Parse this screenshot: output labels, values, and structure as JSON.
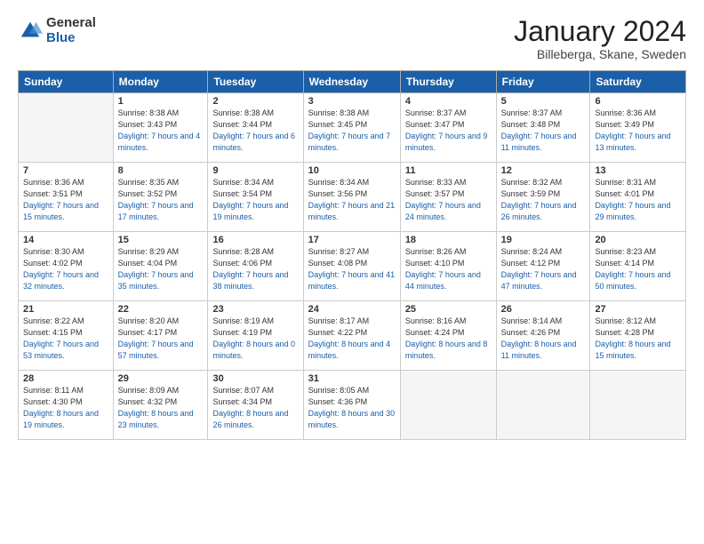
{
  "header": {
    "logo_general": "General",
    "logo_blue": "Blue",
    "month_title": "January 2024",
    "location": "Billeberga, Skane, Sweden"
  },
  "weekdays": [
    "Sunday",
    "Monday",
    "Tuesday",
    "Wednesday",
    "Thursday",
    "Friday",
    "Saturday"
  ],
  "weeks": [
    [
      {
        "day": "",
        "sunrise": "",
        "sunset": "",
        "daylight": ""
      },
      {
        "day": "1",
        "sunrise": "Sunrise: 8:38 AM",
        "sunset": "Sunset: 3:43 PM",
        "daylight": "Daylight: 7 hours and 4 minutes."
      },
      {
        "day": "2",
        "sunrise": "Sunrise: 8:38 AM",
        "sunset": "Sunset: 3:44 PM",
        "daylight": "Daylight: 7 hours and 6 minutes."
      },
      {
        "day": "3",
        "sunrise": "Sunrise: 8:38 AM",
        "sunset": "Sunset: 3:45 PM",
        "daylight": "Daylight: 7 hours and 7 minutes."
      },
      {
        "day": "4",
        "sunrise": "Sunrise: 8:37 AM",
        "sunset": "Sunset: 3:47 PM",
        "daylight": "Daylight: 7 hours and 9 minutes."
      },
      {
        "day": "5",
        "sunrise": "Sunrise: 8:37 AM",
        "sunset": "Sunset: 3:48 PM",
        "daylight": "Daylight: 7 hours and 11 minutes."
      },
      {
        "day": "6",
        "sunrise": "Sunrise: 8:36 AM",
        "sunset": "Sunset: 3:49 PM",
        "daylight": "Daylight: 7 hours and 13 minutes."
      }
    ],
    [
      {
        "day": "7",
        "sunrise": "Sunrise: 8:36 AM",
        "sunset": "Sunset: 3:51 PM",
        "daylight": "Daylight: 7 hours and 15 minutes."
      },
      {
        "day": "8",
        "sunrise": "Sunrise: 8:35 AM",
        "sunset": "Sunset: 3:52 PM",
        "daylight": "Daylight: 7 hours and 17 minutes."
      },
      {
        "day": "9",
        "sunrise": "Sunrise: 8:34 AM",
        "sunset": "Sunset: 3:54 PM",
        "daylight": "Daylight: 7 hours and 19 minutes."
      },
      {
        "day": "10",
        "sunrise": "Sunrise: 8:34 AM",
        "sunset": "Sunset: 3:56 PM",
        "daylight": "Daylight: 7 hours and 21 minutes."
      },
      {
        "day": "11",
        "sunrise": "Sunrise: 8:33 AM",
        "sunset": "Sunset: 3:57 PM",
        "daylight": "Daylight: 7 hours and 24 minutes."
      },
      {
        "day": "12",
        "sunrise": "Sunrise: 8:32 AM",
        "sunset": "Sunset: 3:59 PM",
        "daylight": "Daylight: 7 hours and 26 minutes."
      },
      {
        "day": "13",
        "sunrise": "Sunrise: 8:31 AM",
        "sunset": "Sunset: 4:01 PM",
        "daylight": "Daylight: 7 hours and 29 minutes."
      }
    ],
    [
      {
        "day": "14",
        "sunrise": "Sunrise: 8:30 AM",
        "sunset": "Sunset: 4:02 PM",
        "daylight": "Daylight: 7 hours and 32 minutes."
      },
      {
        "day": "15",
        "sunrise": "Sunrise: 8:29 AM",
        "sunset": "Sunset: 4:04 PM",
        "daylight": "Daylight: 7 hours and 35 minutes."
      },
      {
        "day": "16",
        "sunrise": "Sunrise: 8:28 AM",
        "sunset": "Sunset: 4:06 PM",
        "daylight": "Daylight: 7 hours and 38 minutes."
      },
      {
        "day": "17",
        "sunrise": "Sunrise: 8:27 AM",
        "sunset": "Sunset: 4:08 PM",
        "daylight": "Daylight: 7 hours and 41 minutes."
      },
      {
        "day": "18",
        "sunrise": "Sunrise: 8:26 AM",
        "sunset": "Sunset: 4:10 PM",
        "daylight": "Daylight: 7 hours and 44 minutes."
      },
      {
        "day": "19",
        "sunrise": "Sunrise: 8:24 AM",
        "sunset": "Sunset: 4:12 PM",
        "daylight": "Daylight: 7 hours and 47 minutes."
      },
      {
        "day": "20",
        "sunrise": "Sunrise: 8:23 AM",
        "sunset": "Sunset: 4:14 PM",
        "daylight": "Daylight: 7 hours and 50 minutes."
      }
    ],
    [
      {
        "day": "21",
        "sunrise": "Sunrise: 8:22 AM",
        "sunset": "Sunset: 4:15 PM",
        "daylight": "Daylight: 7 hours and 53 minutes."
      },
      {
        "day": "22",
        "sunrise": "Sunrise: 8:20 AM",
        "sunset": "Sunset: 4:17 PM",
        "daylight": "Daylight: 7 hours and 57 minutes."
      },
      {
        "day": "23",
        "sunrise": "Sunrise: 8:19 AM",
        "sunset": "Sunset: 4:19 PM",
        "daylight": "Daylight: 8 hours and 0 minutes."
      },
      {
        "day": "24",
        "sunrise": "Sunrise: 8:17 AM",
        "sunset": "Sunset: 4:22 PM",
        "daylight": "Daylight: 8 hours and 4 minutes."
      },
      {
        "day": "25",
        "sunrise": "Sunrise: 8:16 AM",
        "sunset": "Sunset: 4:24 PM",
        "daylight": "Daylight: 8 hours and 8 minutes."
      },
      {
        "day": "26",
        "sunrise": "Sunrise: 8:14 AM",
        "sunset": "Sunset: 4:26 PM",
        "daylight": "Daylight: 8 hours and 11 minutes."
      },
      {
        "day": "27",
        "sunrise": "Sunrise: 8:12 AM",
        "sunset": "Sunset: 4:28 PM",
        "daylight": "Daylight: 8 hours and 15 minutes."
      }
    ],
    [
      {
        "day": "28",
        "sunrise": "Sunrise: 8:11 AM",
        "sunset": "Sunset: 4:30 PM",
        "daylight": "Daylight: 8 hours and 19 minutes."
      },
      {
        "day": "29",
        "sunrise": "Sunrise: 8:09 AM",
        "sunset": "Sunset: 4:32 PM",
        "daylight": "Daylight: 8 hours and 23 minutes."
      },
      {
        "day": "30",
        "sunrise": "Sunrise: 8:07 AM",
        "sunset": "Sunset: 4:34 PM",
        "daylight": "Daylight: 8 hours and 26 minutes."
      },
      {
        "day": "31",
        "sunrise": "Sunrise: 8:05 AM",
        "sunset": "Sunset: 4:36 PM",
        "daylight": "Daylight: 8 hours and 30 minutes."
      },
      {
        "day": "",
        "sunrise": "",
        "sunset": "",
        "daylight": ""
      },
      {
        "day": "",
        "sunrise": "",
        "sunset": "",
        "daylight": ""
      },
      {
        "day": "",
        "sunrise": "",
        "sunset": "",
        "daylight": ""
      }
    ]
  ]
}
